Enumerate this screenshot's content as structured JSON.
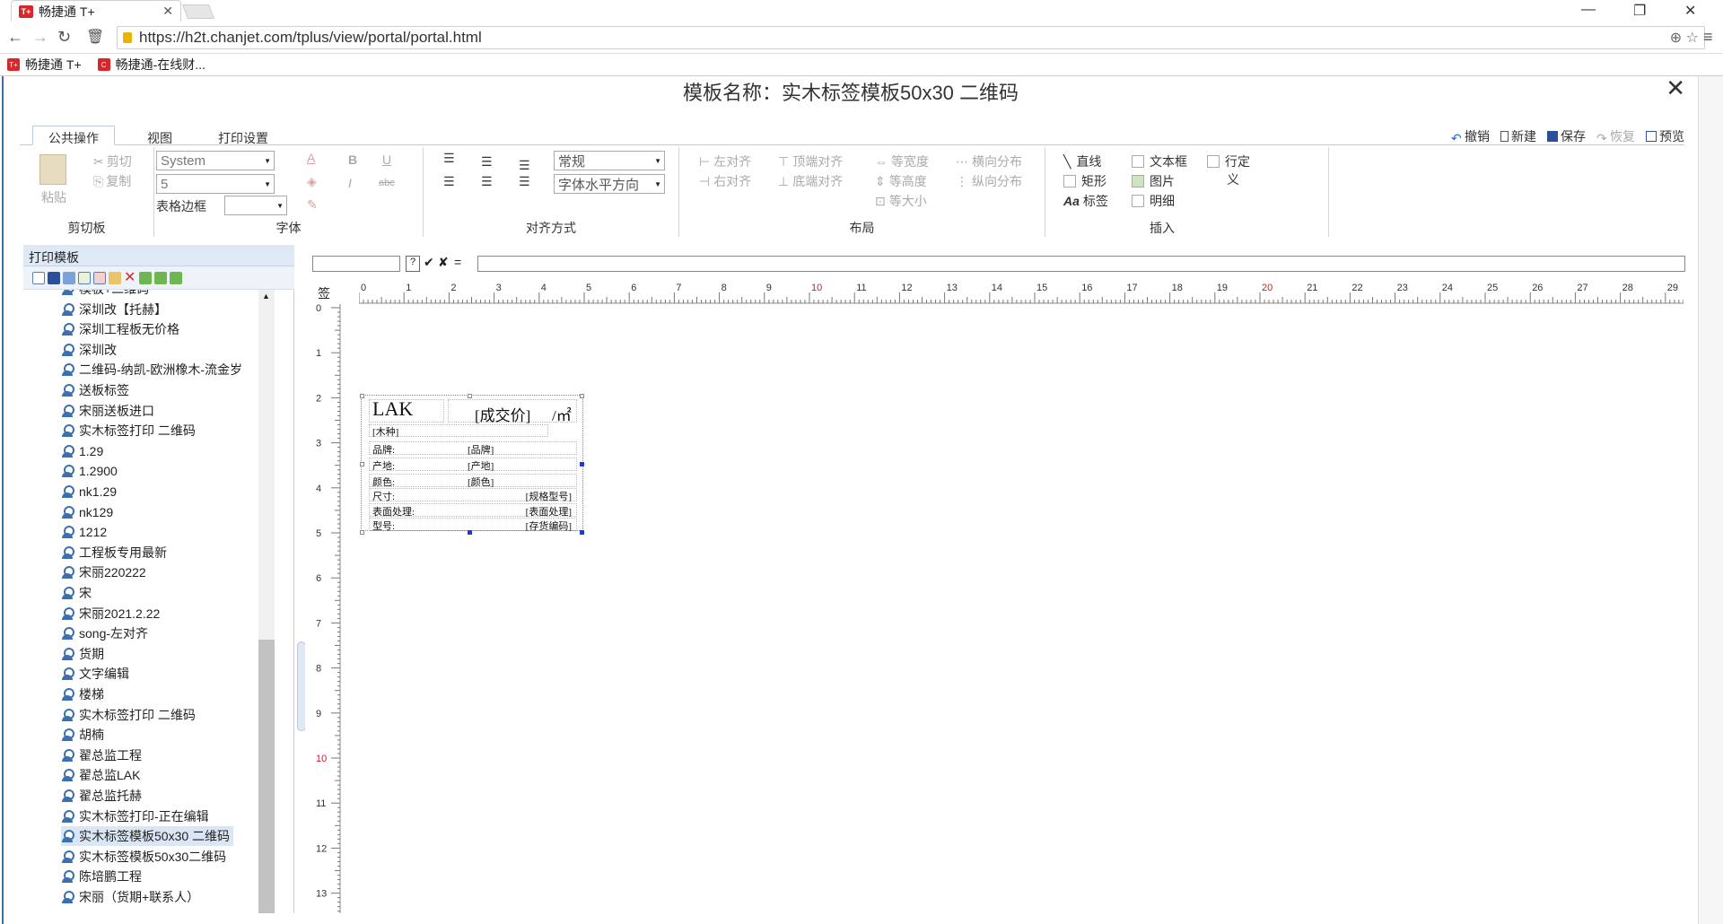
{
  "browser": {
    "tab_title": "畅捷通 T+",
    "tab_logo": "T+",
    "url": "https://h2t.chanjet.com/tplus/view/portal/portal.html",
    "bookmarks": [
      {
        "label": "畅捷通 T+",
        "logo": "T+"
      },
      {
        "label": "畅捷通-在线财...",
        "logo": "C"
      }
    ]
  },
  "dialog": {
    "title": "模板名称：实木标签模板50x30 二维码"
  },
  "ribbon": {
    "tabs": [
      "公共操作",
      "视图",
      "打印设置"
    ],
    "tools": {
      "undo": "撤销",
      "new": "新建",
      "save": "保存",
      "restore": "恢复",
      "preview": "预览"
    },
    "clipboard": {
      "label": "剪切板",
      "paste": "粘贴",
      "cut": "剪切",
      "copy": "复制"
    },
    "font": {
      "label": "字体",
      "family": "System",
      "size": "5",
      "border_label": "表格边框",
      "border_value": "",
      "bold": "B",
      "italic": "I",
      "underline": "U",
      "strike": "abc"
    },
    "align": {
      "label": "对齐方式",
      "style": "常规",
      "direction": "字体水平方向"
    },
    "layout": {
      "label": "布局",
      "left": "左对齐",
      "right": "右对齐",
      "top": "顶端对齐",
      "bottom": "底端对齐",
      "same_width": "等宽度",
      "same_height": "等高度",
      "same_size": "等大小",
      "h_dist": "横向分布",
      "v_dist": "纵向分布"
    },
    "insert": {
      "label": "插入",
      "line": "直线",
      "rect": "矩形",
      "label_item": "标签",
      "textbox": "文本框",
      "image": "图片",
      "detail": "明细",
      "custom": "行定",
      "custom2": "义"
    }
  },
  "formula_bar": {
    "equals": "=",
    "help": "?"
  },
  "left_panel": {
    "title": "打印模板",
    "items": [
      "模板+二维码",
      "深圳改【托赫】",
      "深圳工程板无价格",
      "深圳改",
      "二维码-纳凯-欧洲橡木-流金岁",
      "送板标签",
      "宋丽送板进口",
      "实木标签打印 二维码",
      "1.29",
      "1.2900",
      "nk1.29",
      "nk129",
      "1212",
      "工程板专用最新",
      "宋丽220222",
      "宋",
      "宋丽2021.2.22",
      "song-左对齐",
      "货期",
      "文字编辑",
      "楼梯",
      "实木标签打印 二维码",
      "胡楠",
      "翟总监工程",
      "翟总监LAK",
      "翟总监托赫",
      "实木标签打印-正在编辑",
      "实木标签模板50x30 二维码",
      "实木标签模板50x30二维码",
      "陈培鹏工程",
      "宋丽（货期+联系人）"
    ],
    "selected_index": 27
  },
  "ruler": {
    "corner": "签",
    "h_marks": [
      "0",
      "1",
      "2",
      "3",
      "4",
      "5",
      "6",
      "7",
      "8",
      "9",
      "10",
      "11",
      "12",
      "13",
      "14",
      "15",
      "16",
      "17",
      "18",
      "19",
      "20",
      "21",
      "22",
      "23",
      "24",
      "25",
      "26",
      "27",
      "28",
      "29"
    ],
    "v_marks": [
      "0",
      "1",
      "2",
      "3",
      "4",
      "5",
      "6",
      "7",
      "8",
      "9",
      "10",
      "11",
      "12",
      "13"
    ],
    "highlight_color": "#e0141e"
  },
  "label": {
    "brand": "LAK",
    "price": "[成交价]",
    "unit": "/㎡",
    "wood": "[木种]",
    "rows": [
      {
        "key": "品牌:",
        "val": "[品牌]"
      },
      {
        "key": "产地:",
        "val": "[产地]"
      },
      {
        "key": "颜色:",
        "val": "[颜色]"
      },
      {
        "key": "尺寸:",
        "val": "[规格型号]"
      },
      {
        "key": "表面处理:",
        "val": "[表面处理]"
      },
      {
        "key": "型号:",
        "val": "[存货编码]"
      }
    ]
  }
}
